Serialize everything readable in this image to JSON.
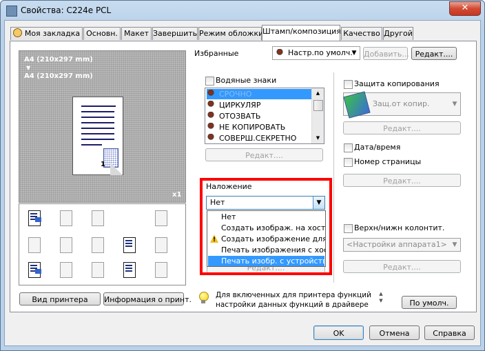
{
  "window": {
    "title": "Свойства: C224e PCL",
    "close_glyph": "✕"
  },
  "tabs": [
    {
      "label": "Моя закладка"
    },
    {
      "label": "Основн."
    },
    {
      "label": "Макет"
    },
    {
      "label": "Завершить"
    },
    {
      "label": "Режим обложки"
    },
    {
      "label": "Штамп/композиция",
      "active": true
    },
    {
      "label": "Качество"
    },
    {
      "label": "Другой"
    }
  ],
  "preview": {
    "paper_top": "A4 (210x297 mm)",
    "arrow": "▼",
    "paper_bottom": "A4 (210x297 mm)",
    "copies": "x1",
    "page_number": "1"
  },
  "favorites": {
    "label": "Избранные",
    "selected": "Настр.по умолч.",
    "add_label": "Добавить...",
    "edit_label": "Редакт...."
  },
  "watermarks": {
    "label": "Водяные знаки",
    "items": [
      "СРОЧНО",
      "ЦИРКУЛЯР",
      "ОТОЗВАТЬ",
      "НЕ КОПИРОВАТЬ",
      "СОВЕРШ.СЕКРЕТНО"
    ],
    "selected_index": 0,
    "edit_label": "Редакт...."
  },
  "overlay": {
    "label": "Наложение",
    "selected": "Нет",
    "options": [
      "Нет",
      "Создать изображ. на хосте",
      "Создать изображение для пап",
      "Печать изображения с хоста",
      "Печать изобр. с устройства"
    ],
    "highlighted_index": 4,
    "warning_index": 2,
    "hidden_button_label": "Редакт...."
  },
  "copy_protect": {
    "label": "Защита копирования",
    "selected": "Защ.от копир.",
    "edit_label": "Редакт...."
  },
  "datetime": {
    "label": "Дата/время"
  },
  "page_number": {
    "label": "Номер страницы",
    "edit_label": "Редакт...."
  },
  "header_footer": {
    "label": "Верхн/нижн колонтит.",
    "selected": "<Настройки аппарата1>",
    "edit_label": "Редакт...."
  },
  "bottom_left": {
    "printer_view": "Вид принтера",
    "printer_info": "Информация о принт."
  },
  "hint": {
    "text": "Для включенных для принтера функций настройки данных функций в драйвере будут"
  },
  "defaults_label": "По умолч.",
  "footer": {
    "ok": "OK",
    "cancel": "Отмена",
    "help": "Справка"
  }
}
